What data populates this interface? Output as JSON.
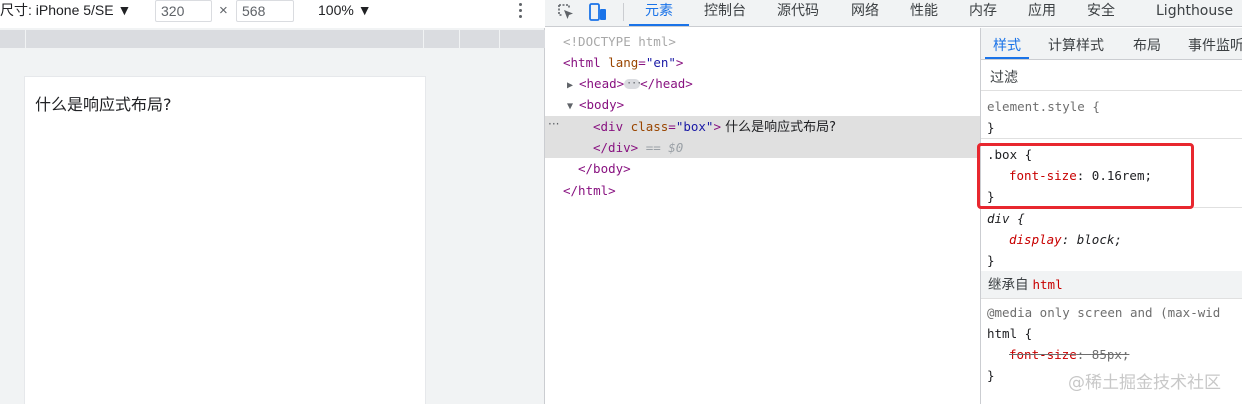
{
  "device_toolbar": {
    "device_label": "尺寸: iPhone 5/SE ▼",
    "width": "320",
    "times": "×",
    "height": "568",
    "zoom": "100% ▼"
  },
  "viewport": {
    "box_text": "什么是响应式布局?"
  },
  "devtools_tabs": [
    {
      "label": "元素",
      "active": true
    },
    {
      "label": "控制台"
    },
    {
      "label": "源代码"
    },
    {
      "label": "网络"
    },
    {
      "label": "性能"
    },
    {
      "label": "内存"
    },
    {
      "label": "应用"
    },
    {
      "label": "安全"
    },
    {
      "label": "Lighthouse"
    }
  ],
  "dom": {
    "doctype": "<!DOCTYPE html>",
    "html_open_tag": "<html",
    "html_attr": "lang",
    "html_attr_val": "\"en\"",
    "html_open_end": ">",
    "head_open": "<head>",
    "head_close": "</head>",
    "body_open": "<body>",
    "div_open": "<div",
    "div_attr": "class",
    "div_attr_val": "\"box\"",
    "div_open_end": ">",
    "div_text": " 什么是响应式布局?",
    "div_close": "</div>",
    "dollar_zero": "== $0",
    "body_close": "</body>",
    "html_close": "</html>",
    "row_dots": "···"
  },
  "styles": {
    "sub_tabs": [
      {
        "label": "样式",
        "active": true
      },
      {
        "label": "计算样式"
      },
      {
        "label": "布局"
      },
      {
        "label": "事件监听"
      }
    ],
    "filter_placeholder": "过滤",
    "element_style_selector": "element.style {",
    "close_brace": "}",
    "box_selector": ".box {",
    "box_prop": "font-size",
    "box_value": "0.16rem;",
    "div_selector": "div {",
    "div_prop": "display",
    "div_value": "block;",
    "inherited_label": "继承自",
    "inherited_tag": "html",
    "media_query": "@media only screen and (max-wid",
    "html_selector": "html {",
    "html_prop": "font-size",
    "html_value": "85px;"
  },
  "watermark": "@稀土掘金技术社区",
  "colors": {
    "accent": "#1a73e8",
    "highlight": "#e8272f",
    "tag": "#881280",
    "attr_name": "#994500",
    "attr_value": "#1a1aa6",
    "property": "#c80000"
  }
}
